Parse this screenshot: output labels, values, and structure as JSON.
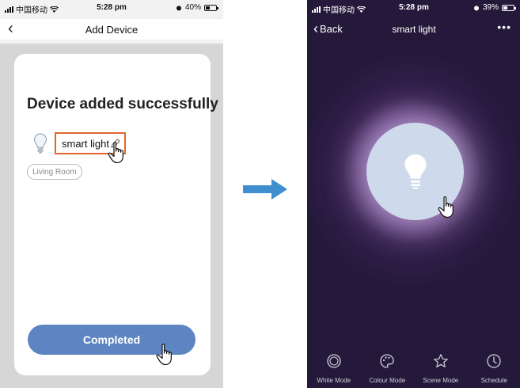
{
  "left_screen": {
    "status": {
      "carrier": "中国移动",
      "time": "5:28 pm",
      "battery": "40%",
      "battery_level": 0.4
    },
    "nav": {
      "title": "Add Device"
    },
    "card": {
      "title": "Device added successfully",
      "device_name": "smart light",
      "room": "Living Room",
      "completed_label": "Completed"
    },
    "colors": {
      "accent": "#e0662a",
      "button": "#5d85c1",
      "card_bg": "#ffffff",
      "backdrop": "#d6d6d6"
    },
    "icons": [
      "back-chevron-icon",
      "bulb-icon",
      "pencil-icon",
      "hand-pointer-icon"
    ]
  },
  "arrow": {
    "color": "#3f8fd0"
  },
  "right_screen": {
    "status": {
      "carrier": "中国移动",
      "time": "5:28 pm",
      "battery": "39%",
      "battery_level": 0.39
    },
    "nav": {
      "back_label": "Back",
      "title": "smart light",
      "more": "•••"
    },
    "tabs": [
      {
        "label": "White Mode",
        "icon": "circle-icon"
      },
      {
        "label": "Colour Mode",
        "icon": "palette-icon"
      },
      {
        "label": "Scene Mode",
        "icon": "star-icon"
      },
      {
        "label": "Schedule",
        "icon": "clock-icon"
      }
    ],
    "colors": {
      "background": "#2a1c42",
      "glow": "#b593c6",
      "bulb_circle": "#cfd9ec"
    }
  }
}
